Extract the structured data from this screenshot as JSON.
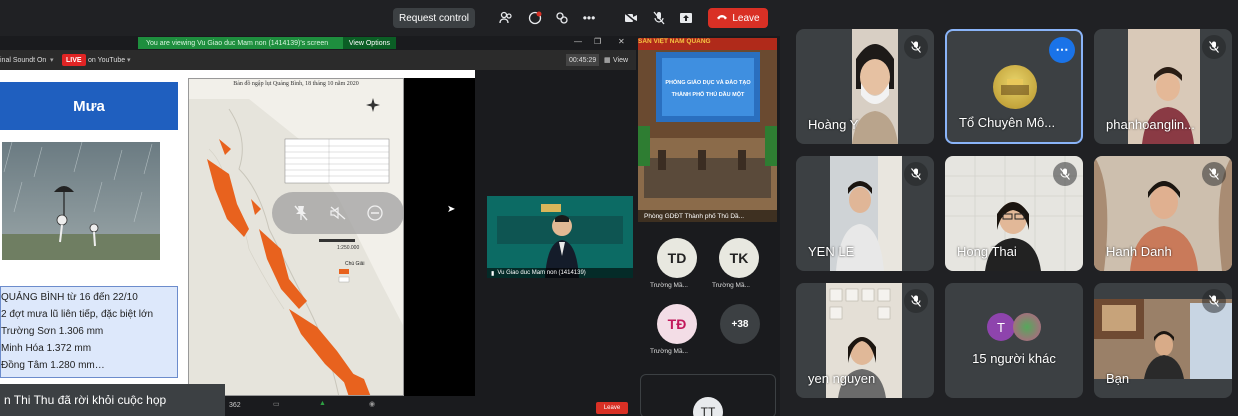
{
  "topbar": {
    "request_control": "Request control",
    "leave": "Leave"
  },
  "shared_screen": {
    "viewing_text": "You are viewing Vu Giao duc Mam non (1414139)'s screen",
    "view_options": "View Options",
    "sound_label": "inal Soundt On",
    "live_badge": "LIVE",
    "live_target": "on YouTube",
    "timer": "00:45:29",
    "view_label": "View",
    "slide": {
      "heading": "Mưa",
      "map_title": "Bản đồ ngập lụt Quảng Bình, 18 tháng 10 năm 2020",
      "legend_title": "Chú Giải",
      "scale": "1:250.000",
      "lines": [
        "QUẢNG BÌNH từ 16 đến 22/10",
        "2 đợt mưa lũ liên tiếp, đặc biệt lớn",
        "Trường Sơn 1.306 mm",
        "Minh Hóa 1.372 mm",
        "Đồng Tâm 1.280 mm…"
      ]
    },
    "thumb_label": "Vu Giao duc Mam non (1414139)",
    "toast": "n Thi Thu đã rời khỏi cuộc họp",
    "participants_count": "362",
    "leave_small": "Leave",
    "room": {
      "banner": "SẢN VIỆT NAM QUANG",
      "sign_line1": "PHÒNG GIÁO DỤC VÀ ĐÀO TẠO",
      "sign_line2": "THÀNH PHỐ THỦ DẦU MỘT",
      "label": "Phòng GDĐT Thành phố Thủ Dầ..."
    },
    "mini_tiles": [
      {
        "initials": "TD",
        "name": "Trường Mầ...",
        "color": "#e8e8e0"
      },
      {
        "initials": "TK",
        "name": "Trường Mầ...",
        "color": "#e8e8e0"
      },
      {
        "initials": "TĐ",
        "name": "Trường Mầ...",
        "color": "#f3dde6"
      }
    ],
    "more_count": "+38",
    "tt_initials": "TT"
  },
  "participants": [
    {
      "name": "Hoàng Y"
    },
    {
      "name": "Tổ Chuyên Mô..."
    },
    {
      "name": "phanhoanglin..."
    },
    {
      "name": "YEN LE"
    },
    {
      "name": "Hong Thai"
    },
    {
      "name": "Hanh Danh"
    },
    {
      "name": "yen nguyen"
    },
    {
      "name": "15 người khác",
      "avatar_letter": "T"
    },
    {
      "name": "Bạn"
    }
  ],
  "colors": {
    "background": "#202124",
    "tile": "#3c4043",
    "leave_red": "#d93025",
    "active_border": "#8ab4f8",
    "accent_blue": "#1a73e8"
  },
  "icons": {
    "mic_off": "mic-off-icon",
    "more": "more-vert-icon"
  }
}
